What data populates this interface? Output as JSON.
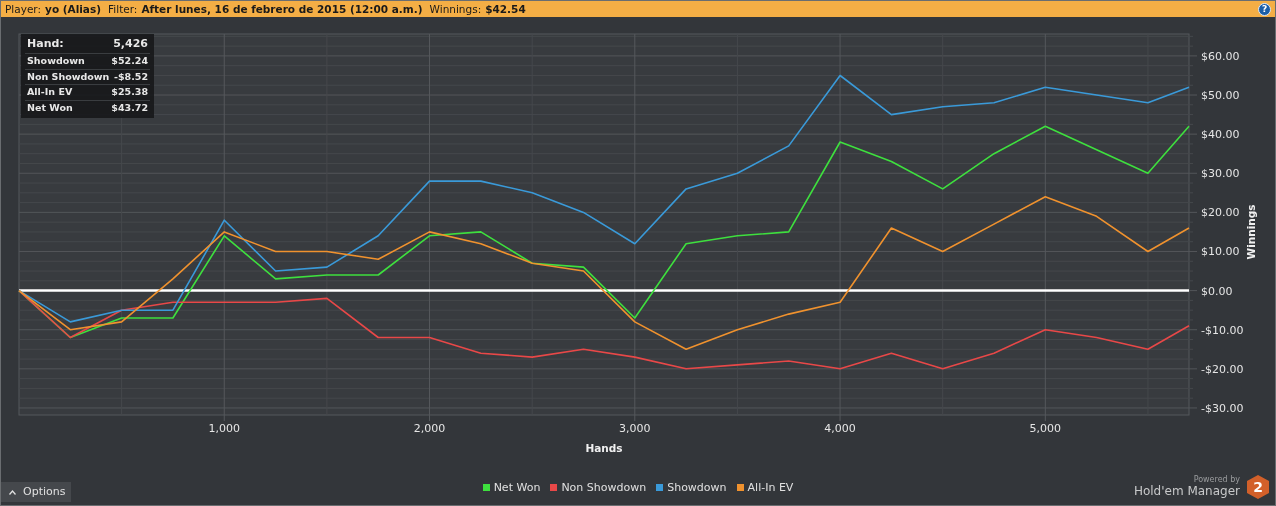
{
  "header": {
    "player_label": "Player:",
    "player": "yo (Alias)",
    "filter_label": "Filter:",
    "filter": "After lunes, 16 de febrero de 2015 (12:00 a.m.)",
    "winnings_label": "Winnings:",
    "winnings": "$42.54",
    "help": "?"
  },
  "stats": [
    {
      "kind": "head",
      "label": "Hand:",
      "value": "5,426"
    },
    {
      "kind": "row",
      "label": "Showdown",
      "value": "$52.24"
    },
    {
      "kind": "row",
      "label": "Non Showdown",
      "value": "-$8.52"
    },
    {
      "kind": "row",
      "label": "All-In EV",
      "value": "$25.38"
    },
    {
      "kind": "row",
      "label": "Net Won",
      "value": "$43.72"
    }
  ],
  "chart_data": {
    "type": "line",
    "grid": true,
    "xlabel": "Hands",
    "ylabel": "Winnings",
    "xlim": [
      0,
      5700
    ],
    "ylim": [
      -31.8,
      65.6
    ],
    "x": [
      0,
      250,
      500,
      750,
      1000,
      1250,
      1500,
      1750,
      2000,
      2250,
      2500,
      2750,
      3000,
      3250,
      3500,
      3750,
      4000,
      4250,
      4500,
      4750,
      5000,
      5250,
      5500,
      5700
    ],
    "xticks": [
      {
        "value": 1000,
        "label": "1,000"
      },
      {
        "value": 2000,
        "label": "2,000"
      },
      {
        "value": 3000,
        "label": "3,000"
      },
      {
        "value": 4000,
        "label": "4,000"
      },
      {
        "value": 5000,
        "label": "5,000"
      }
    ],
    "yticks": [
      {
        "value": 60,
        "label": "$60.00"
      },
      {
        "value": 50,
        "label": "$50.00"
      },
      {
        "value": 40,
        "label": "$40.00"
      },
      {
        "value": 30,
        "label": "$30.00"
      },
      {
        "value": 20,
        "label": "$20.00"
      },
      {
        "value": 10,
        "label": "$10.00"
      },
      {
        "value": 0,
        "label": "$0.00"
      },
      {
        "value": -10,
        "label": "-$10.00"
      },
      {
        "value": -20,
        "label": "-$20.00"
      },
      {
        "value": -30,
        "label": "-$30.00"
      }
    ],
    "series": [
      {
        "name": "Net Won",
        "color": "#3ee03e",
        "values": [
          0,
          -12,
          -7,
          -7,
          14,
          3,
          4,
          4,
          14,
          15,
          7,
          6,
          -7,
          12,
          14,
          15,
          38,
          33,
          26,
          35,
          42,
          36,
          30,
          42
        ]
      },
      {
        "name": "Non Showdown",
        "color": "#e84848",
        "values": [
          0,
          -12,
          -5,
          -3,
          -3,
          -3,
          -2,
          -12,
          -12,
          -16,
          -17,
          -15,
          -17,
          -20,
          -19,
          -18,
          -20,
          -16,
          -20,
          -16,
          -10,
          -12,
          -15,
          -9
        ]
      },
      {
        "name": "Showdown",
        "color": "#3a9ad9",
        "values": [
          0,
          -8,
          -5,
          -5,
          18,
          5,
          6,
          14,
          28,
          28,
          25,
          20,
          12,
          26,
          30,
          37,
          55,
          45,
          47,
          48,
          52,
          50,
          48,
          52
        ]
      },
      {
        "name": "All-In EV",
        "color": "#f0922e",
        "values": [
          0,
          -10,
          -8,
          3,
          15,
          10,
          10,
          8,
          15,
          12,
          7,
          5,
          -8,
          -15,
          -10,
          -6,
          -3,
          16,
          10,
          17,
          24,
          19,
          10,
          16
        ]
      }
    ]
  },
  "options_button": "Options",
  "branding": {
    "powered_by": "Powered by",
    "product": "Hold'em Manager",
    "badge": "2"
  }
}
